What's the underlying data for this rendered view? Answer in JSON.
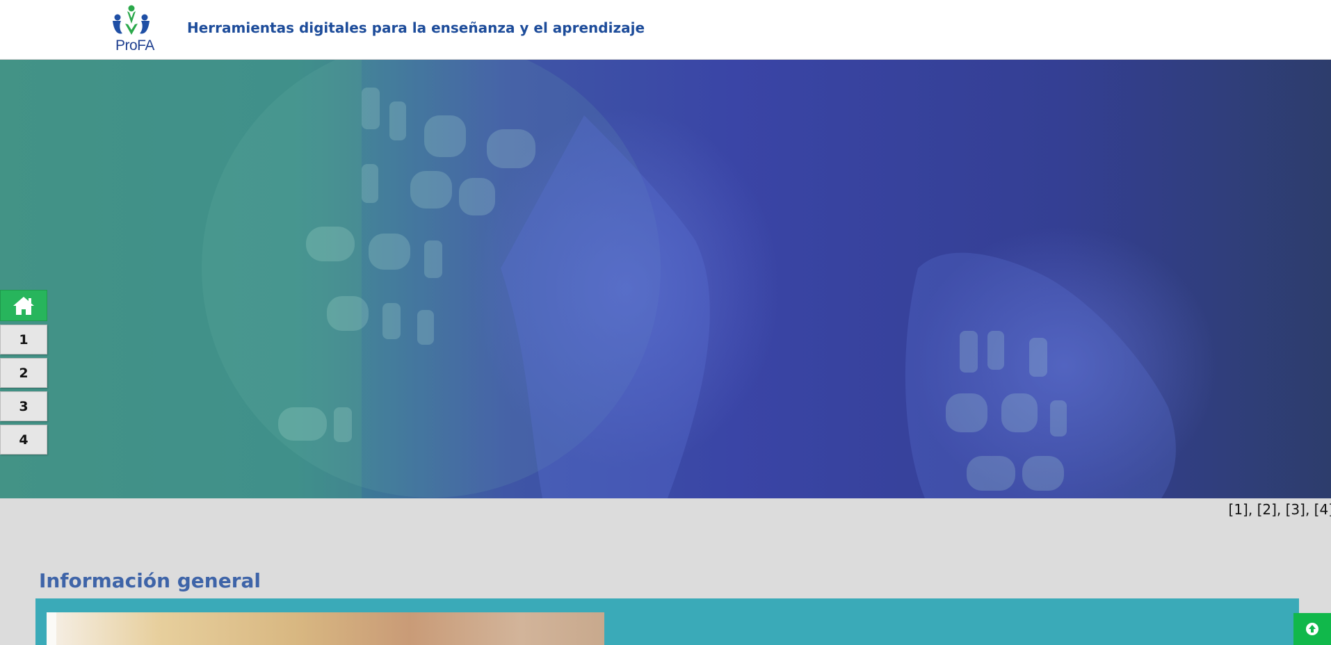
{
  "header": {
    "logo_text": "ProFA",
    "site_title": "Herramientas digitales para la enseñanza y el aprendizaje"
  },
  "sidenav": {
    "home_icon": "home-icon",
    "items": [
      {
        "label": "1"
      },
      {
        "label": "2"
      },
      {
        "label": "3"
      },
      {
        "label": "4"
      }
    ]
  },
  "hero": {
    "references": "[1], [2], [3], [4]"
  },
  "main": {
    "section_title": "Información general"
  },
  "back_to_top": {
    "icon": "arrow-up-circle-icon"
  },
  "colors": {
    "title_blue": "#1d4c9a",
    "section_blue": "#3e64a8",
    "nav_green": "#27b55c",
    "panel_teal": "#3aaab8",
    "background_gray": "#dcdcdc"
  }
}
